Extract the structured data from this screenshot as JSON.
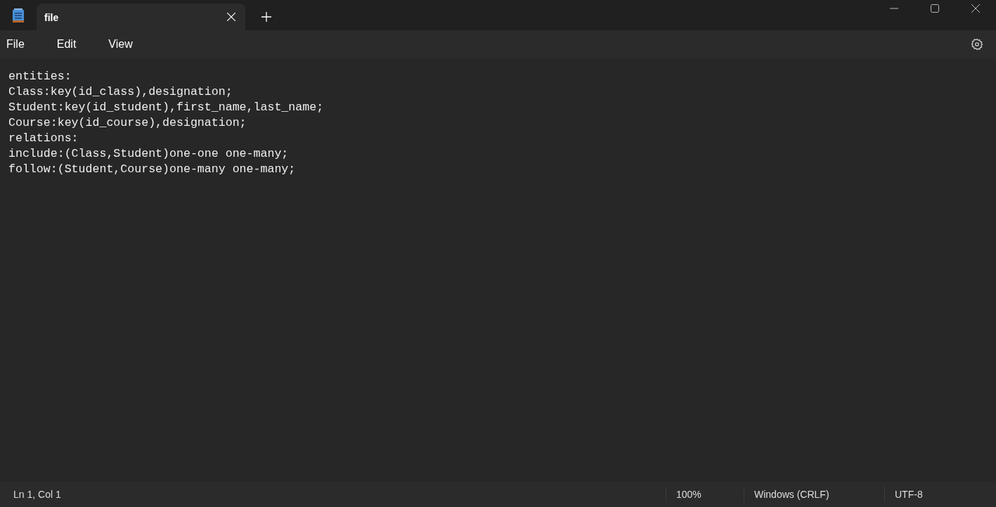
{
  "tabs": [
    {
      "label": "file",
      "selected": true
    }
  ],
  "menu": [
    "File",
    "Edit",
    "View"
  ],
  "editor": {
    "lines": [
      "entities:",
      "Class:key(id_class),designation;",
      "Student:key(id_student),first_name,last_name;",
      "Course:key(id_course),designation;",
      "relations:",
      "include:(Class,Student)one-one one-many;",
      "follow:(Student,Course)one-many one-many;"
    ]
  },
  "status_bar": {
    "position": "Ln 1, Col 1",
    "zoom": "100%",
    "line_ending": "Windows (CRLF)",
    "encoding": "UTF-8"
  }
}
